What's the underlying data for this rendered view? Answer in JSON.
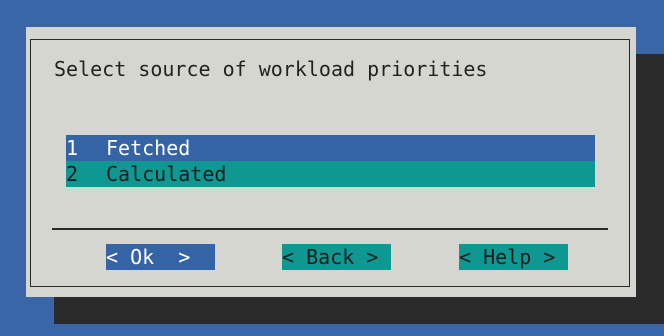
{
  "dialog": {
    "prompt": "Select source of workload priorities",
    "items": [
      {
        "tag": "1",
        "label": "Fetched",
        "selected": true
      },
      {
        "tag": "2",
        "label": "Calculated",
        "selected": false
      }
    ],
    "buttons": {
      "ok": "< Ok  >",
      "back": "< Back >",
      "help": "< Help >"
    }
  },
  "colors": {
    "background": "#3a66a7",
    "dialog": "#d6d6d0",
    "selected": "#3564a6",
    "item": "#0f9791",
    "shadow": "#2a2a2a"
  }
}
